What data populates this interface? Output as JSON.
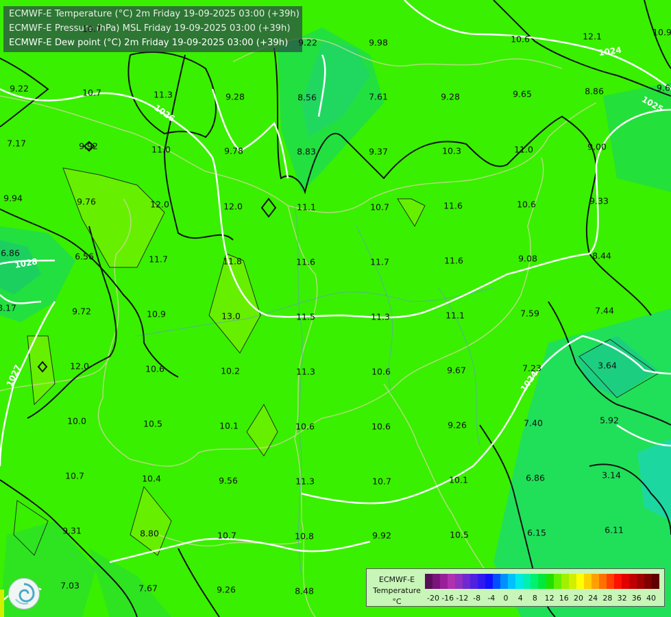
{
  "header": {
    "lines": [
      "ECMWF-E Temperature (°C) 2m Friday 19-09-2025 03:00 (+39h)",
      "ECMWF-E Pressure (hPa) MSL Friday 19-09-2025 03:00 (+39h)",
      "ECMWF-E Dew point (°C) 2m Friday 19-09-2025 03:00 (+39h)"
    ]
  },
  "map": {
    "values": [
      "10.7",
      "9.98",
      "9.22",
      "10.6",
      "12.1",
      "10.9",
      "9.22",
      "10.7",
      "11.3",
      "9.28",
      "8.56",
      "7.61",
      "9.28",
      "9.65",
      "8.86",
      "9.6",
      "7.17",
      "9.92",
      "11.0",
      "9.78",
      "8.83",
      "9.37",
      "10.3",
      "11.0",
      "9.00",
      "9.94",
      "9.76",
      "12.0",
      "12.0",
      "11.1",
      "10.7",
      "11.6",
      "10.6",
      "9.33",
      "6.86",
      "6.56",
      "11.7",
      "11.8",
      "11.6",
      "11.7",
      "11.6",
      "9.08",
      "8.44",
      "8.17",
      "9.72",
      "10.9",
      "13.0",
      "11.5",
      "11.3",
      "11.1",
      "7.59",
      "7.44",
      "12.0",
      "10.6",
      "10.2",
      "11.3",
      "10.6",
      "9.67",
      "7.23",
      "3.64",
      "10.0",
      "10.5",
      "10.1",
      "10.6",
      "10.6",
      "9.26",
      "7.40",
      "5.92",
      "10.7",
      "10.4",
      "9.56",
      "11.3",
      "10.7",
      "10.1",
      "6.86",
      "3.14",
      "9.31",
      "8.80",
      "10.7",
      "10.8",
      "9.92",
      "10.5",
      "6.15",
      "6.11",
      "7.03",
      "7.67",
      "9.26",
      "8.48"
    ],
    "isobar_labels": [
      "1024",
      "1025",
      "1026",
      "1028",
      "1027",
      "1024"
    ]
  },
  "legend": {
    "title_lines": [
      "ECMWF-E",
      "Temperature",
      "°C"
    ],
    "colors": [
      "#5a0e5a",
      "#7a147a",
      "#9a1e9a",
      "#b030b0",
      "#9030c0",
      "#7028d0",
      "#5020e0",
      "#3018f0",
      "#1010ff",
      "#0050ff",
      "#0090ff",
      "#00c0ff",
      "#00e8e8",
      "#00f0b0",
      "#00f070",
      "#00e840",
      "#20e000",
      "#60f000",
      "#a0f000",
      "#d0f000",
      "#ffff00",
      "#ffd000",
      "#ffa000",
      "#ff7000",
      "#ff4000",
      "#ff1000",
      "#e00000",
      "#c00000",
      "#a00000",
      "#800000",
      "#600000"
    ],
    "ticks": [
      "-20",
      "-16",
      "-12",
      "-8",
      "-4",
      "0",
      "4",
      "8",
      "12",
      "16",
      "20",
      "24",
      "28",
      "32",
      "36",
      "40"
    ]
  }
}
